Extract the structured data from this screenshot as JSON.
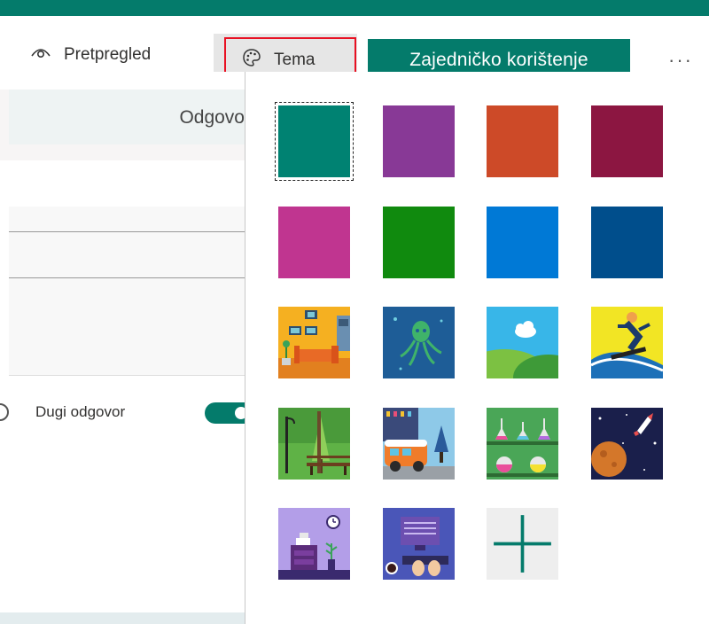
{
  "toolbar": {
    "preview_label": "Pretpregled",
    "theme_label": "Tema",
    "share_label": "Zajedničko korištenje",
    "more_label": "···",
    "accent": "#047b6b"
  },
  "left_pane": {
    "responses_tab": "Odgovo",
    "long_answer_label": "Dugi odgovor"
  },
  "theme_panel": {
    "colors": [
      {
        "name": "teal",
        "hex": "#008272",
        "selected": true
      },
      {
        "name": "purple",
        "hex": "#883996"
      },
      {
        "name": "orange-red",
        "hex": "#cd4a28"
      },
      {
        "name": "maroon",
        "hex": "#8c1641"
      },
      {
        "name": "magenta",
        "hex": "#c03590"
      },
      {
        "name": "green",
        "hex": "#108a0e"
      },
      {
        "name": "blue",
        "hex": "#0079d6"
      },
      {
        "name": "dark-blue",
        "hex": "#004e8c"
      }
    ],
    "images": [
      "living-room",
      "octopus",
      "sky-hills",
      "snowboarder",
      "park-bench",
      "van-city",
      "lab-flasks",
      "space-rocket",
      "desk-clock",
      "typing-screen"
    ],
    "add_custom_icon": "plus-icon"
  }
}
